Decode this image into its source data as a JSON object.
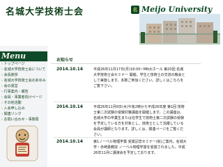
{
  "header": {
    "title": "名城大学技術士会",
    "brand": "Meijo University",
    "seal": "名"
  },
  "sidebar": {
    "menu_title": "Menu",
    "items": [
      "トップページ",
      "名城大学技術士会について",
      "会長挨拶",
      "名城大学技術士会のあゆみ",
      "会の運営",
      "行事案内・報告",
      "会員・事業者向けページ",
      "その他活動",
      "入会申し込み",
      "関連リンク",
      "お問い合わせ・事務局"
    ]
  },
  "news": {
    "title": "お知らせ",
    "entries": [
      {
        "date": "2014.10.14",
        "text": "平成26年11月17日(月)18:00~MN大ホール 第20回 名城大学技術士会セミナー 開催。学生と技術士の交流の機会として実施します。多数ご参加ください。詳しくはこちらをご覧下さい。",
        "link": "詳しくはこちらをご覧下さい。"
      },
      {
        "date": "2014.10.14",
        "text": "平成26年11月6日(木)午後2時から平成26年度 第1回 技術士第二次試験の受験対策講座を開催します。この講座は、名城大学の卒業生または在学生で技術士第二次試験の受験を予定している方を対象とし、技術士として活躍している会員が講師となります。詳しくは、関連ページをご覧ください。",
        "link": "関連ページ"
      },
      {
        "date": "2014.10.14",
        "text": "第1ノーベル物理学賞 受賞記念セミナー(仮)ご案内。名城大学・赤崎勇教授 ノーベル物理学賞を受賞されました。平成26年11月に講演会を予定しております。",
        "warn": "第1ノーベル物理学賞"
      }
    ]
  },
  "colors": {
    "brand_green": "#0e4a28",
    "text_dark": "#0f3f1b",
    "link_blue": "#1d4f9b",
    "warn_red": "#c31e1e"
  },
  "icons": {
    "seal": "university-seal-icon",
    "menu": "menu-banner",
    "mascot": "mascot-image-icon",
    "building": "campus-building-illustration"
  }
}
